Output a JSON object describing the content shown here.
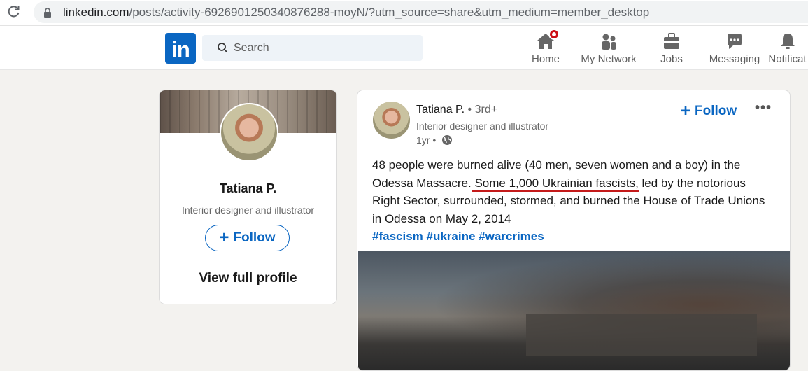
{
  "browser": {
    "url_host": "linkedin.com",
    "url_rest": "/posts/activity-6926901250340876288-moyN/?utm_source=share&utm_medium=member_desktop"
  },
  "nav": {
    "logo": "in",
    "search_placeholder": "Search",
    "items": [
      {
        "label": "Home",
        "icon": "home-icon"
      },
      {
        "label": "My Network",
        "icon": "network-icon"
      },
      {
        "label": "Jobs",
        "icon": "briefcase-icon"
      },
      {
        "label": "Messaging",
        "icon": "messaging-icon"
      },
      {
        "label": "Notificat",
        "icon": "bell-icon"
      }
    ]
  },
  "profile_card": {
    "name": "Tatiana P.",
    "headline": "Interior designer and illustrator",
    "follow_label": "Follow",
    "view_profile_label": "View full profile"
  },
  "post": {
    "author": "Tatiana P.",
    "degree": " • 3rd+",
    "headline": "Interior designer and illustrator",
    "age": "1yr • ",
    "follow_label": "Follow",
    "more_label": "•••",
    "text_part1": "48 people were burned alive (40 men, seven women and a boy) in the Odessa Massacre.",
    "text_underlined": " Some 1,000 Ukrainian fascists,",
    "text_part2": " led by the notorious Right Sector, surrounded, stormed, and burned the House of Trade Unions in Odessa on May 2, 2014",
    "hashtags": "#fascism #ukraine #warcrimes"
  },
  "colors": {
    "linkedin_blue": "#0a66c2",
    "badge_red": "#cc1016",
    "annotation_red": "#c41a1a",
    "page_bg": "#f3f2ef"
  }
}
